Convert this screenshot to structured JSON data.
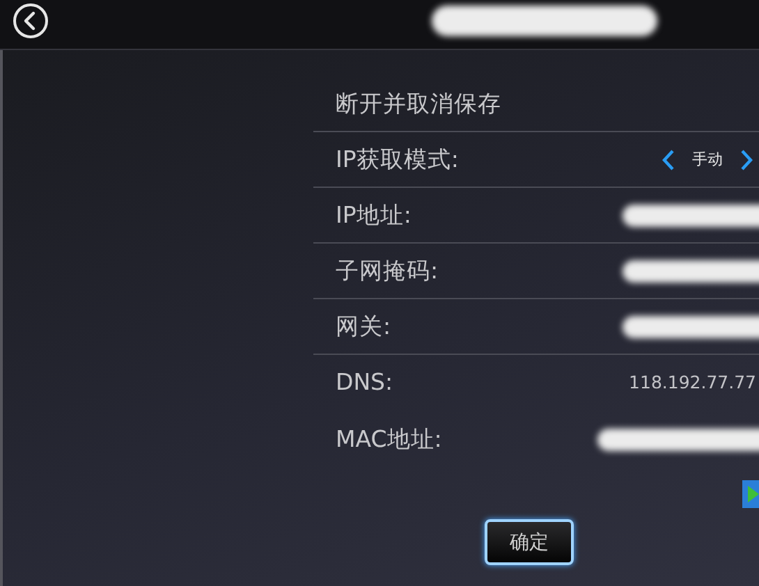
{
  "title": {
    "kind": "redacted"
  },
  "rows": [
    {
      "label": "断开并取消保存",
      "kind": "action"
    },
    {
      "label": "IP获取模式:",
      "kind": "selector",
      "value": "手动"
    },
    {
      "label": "IP地址:",
      "kind": "redacted"
    },
    {
      "label": "子网掩码:",
      "kind": "redacted"
    },
    {
      "label": "网关:",
      "kind": "redacted"
    },
    {
      "label": "DNS:",
      "kind": "text",
      "value": "118.192.77.77"
    },
    {
      "label": "MAC地址:",
      "kind": "redacted"
    }
  ],
  "confirm_button": "确定"
}
